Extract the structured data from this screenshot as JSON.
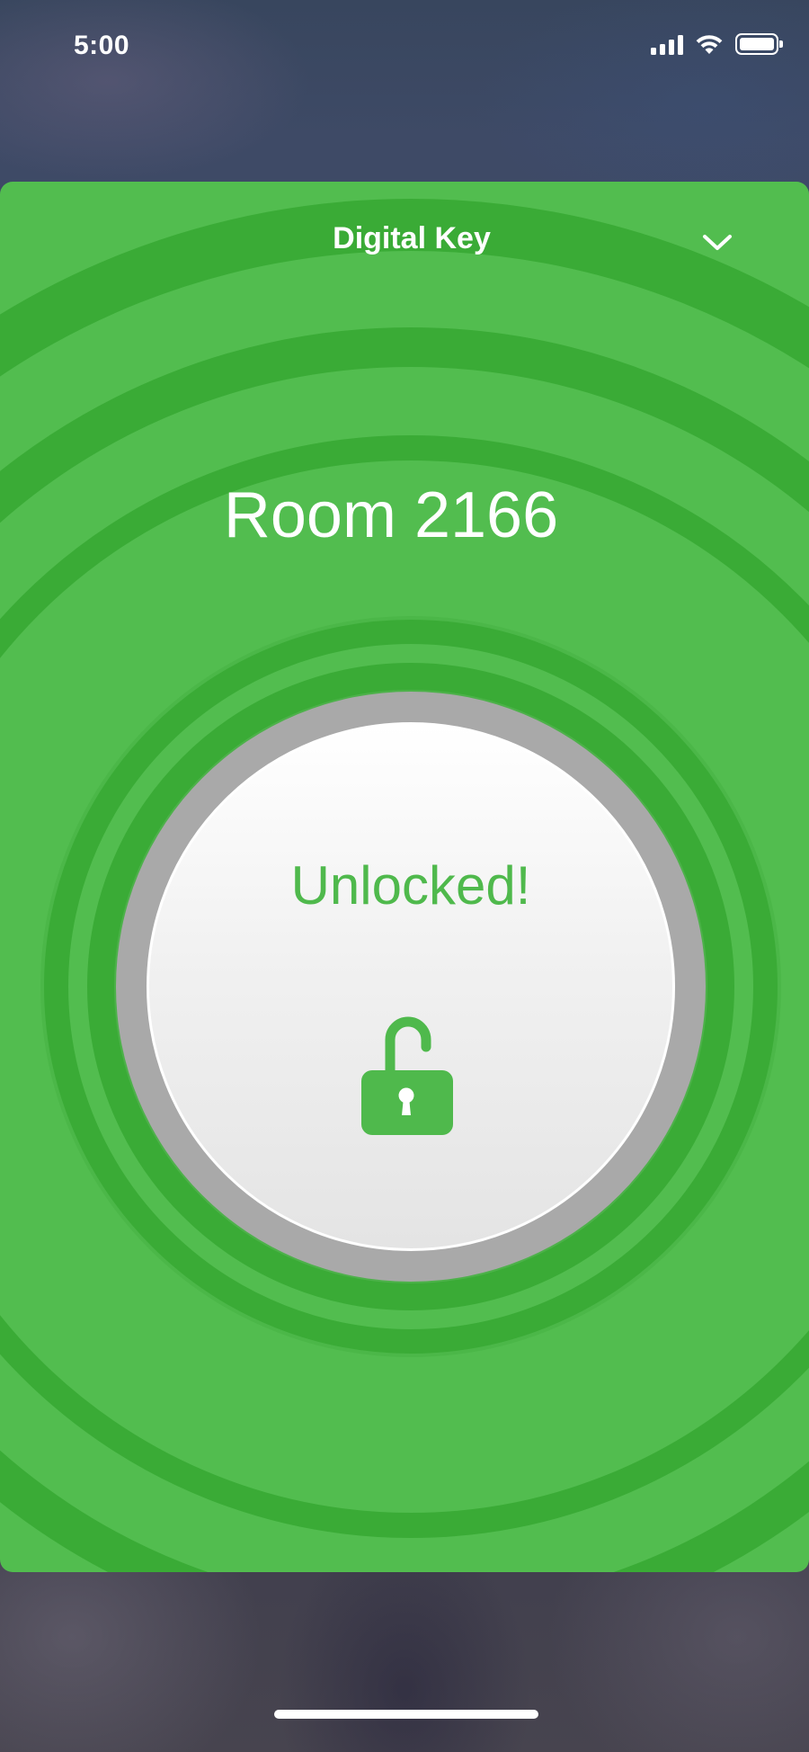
{
  "status_bar": {
    "time": "5:00",
    "icons": [
      "signal-icon",
      "wifi-icon",
      "battery-icon"
    ]
  },
  "card": {
    "title": "Digital Key",
    "collapse_icon": "chevron-down-icon",
    "room": "Room 2166",
    "status_text": "Unlocked!",
    "lock_icon": "unlocked-padlock-icon"
  },
  "colors": {
    "card_green": "#52bd4f",
    "ring_dark_green": "#3aab36",
    "accent_green": "#4fb94c",
    "button_rim": "#a9a9a9"
  }
}
